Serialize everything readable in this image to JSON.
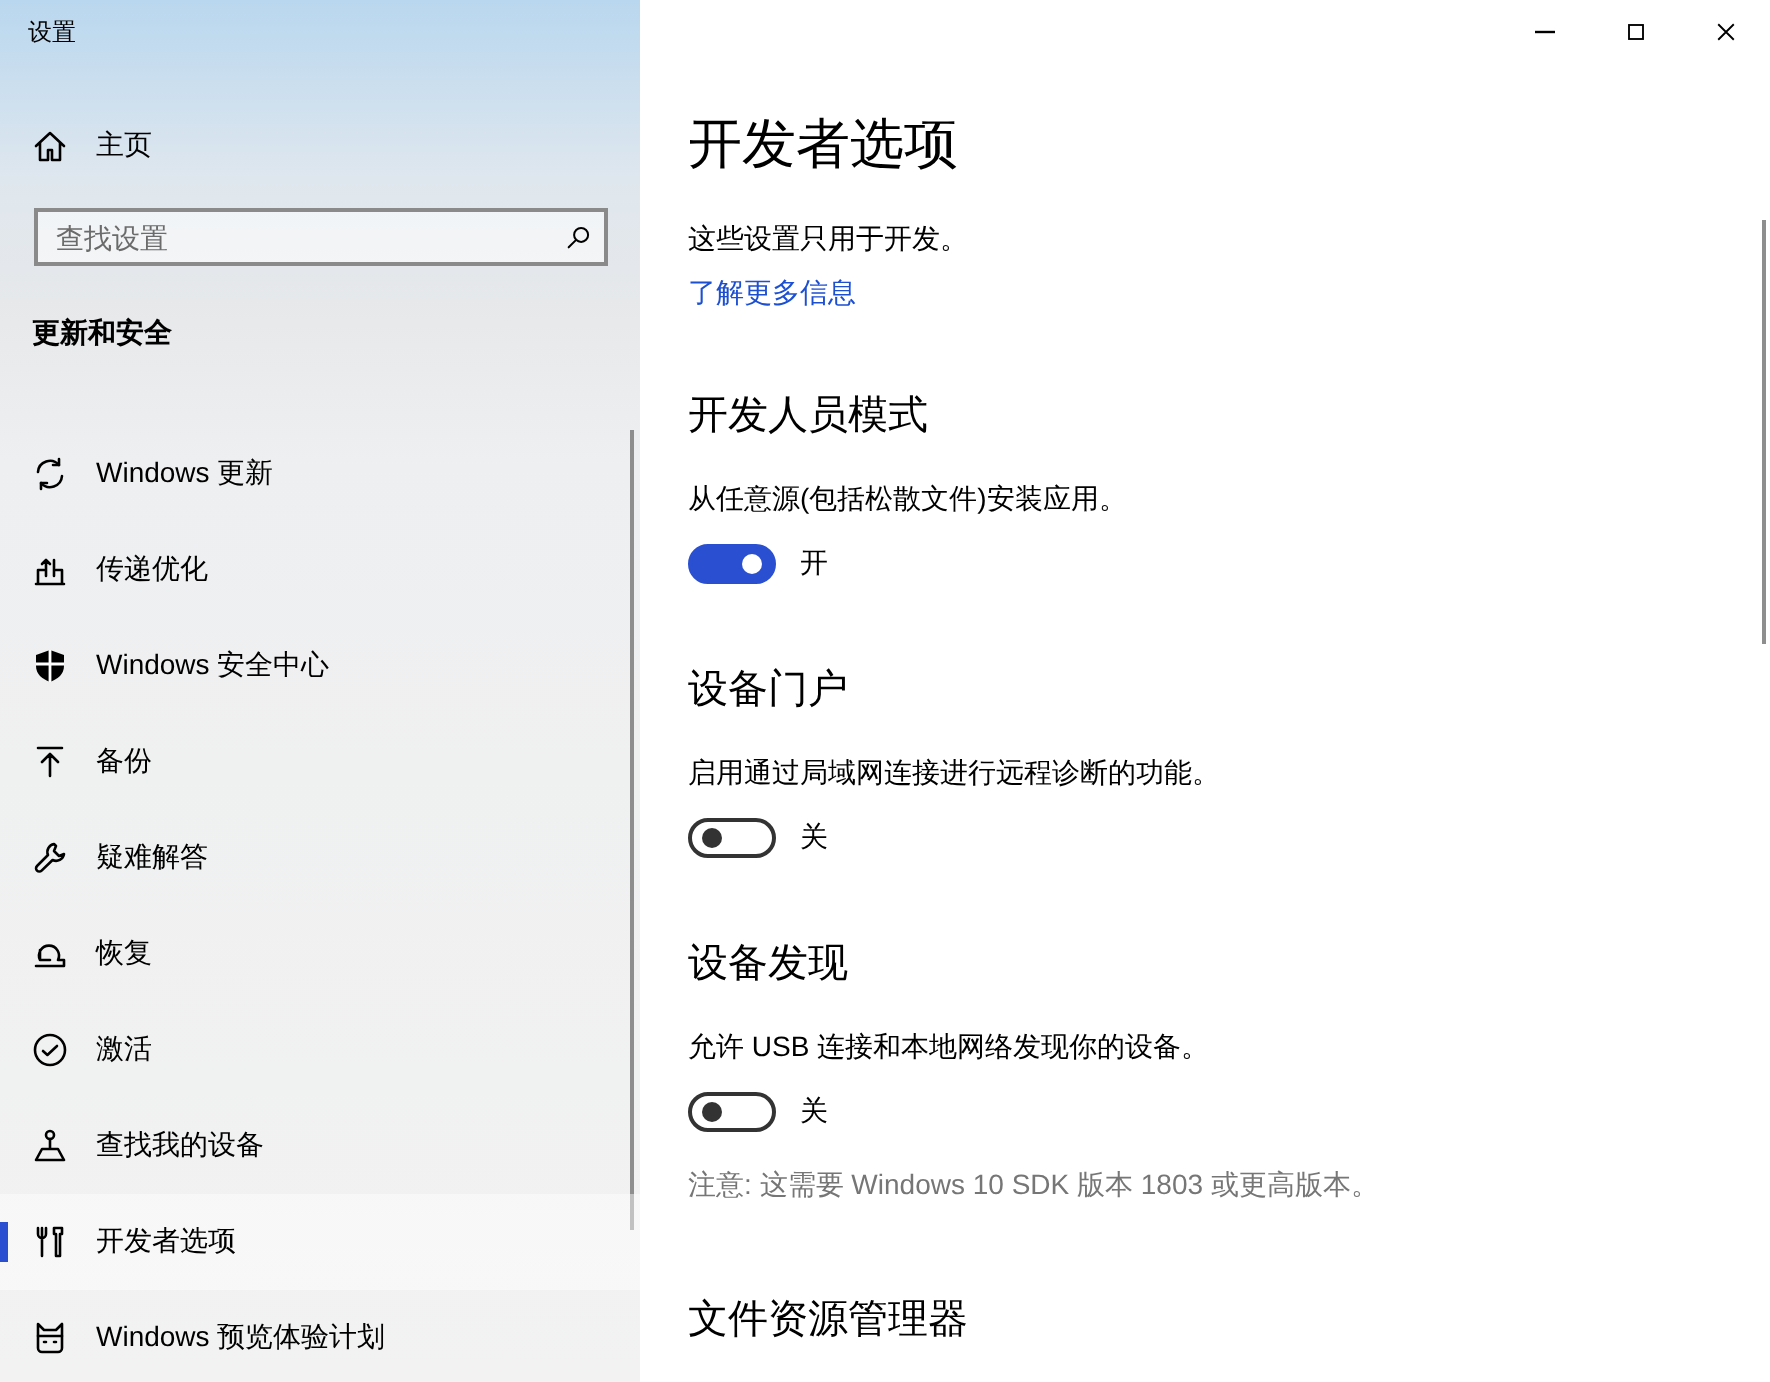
{
  "window": {
    "title": "设置"
  },
  "sidebar": {
    "home": {
      "label": "主页"
    },
    "search": {
      "placeholder": "查找设置"
    },
    "section_title": "更新和安全",
    "items": [
      {
        "label": "Windows 更新",
        "selected": false
      },
      {
        "label": "传递优化",
        "selected": false
      },
      {
        "label": "Windows 安全中心",
        "selected": false
      },
      {
        "label": "备份",
        "selected": false
      },
      {
        "label": "疑难解答",
        "selected": false
      },
      {
        "label": "恢复",
        "selected": false
      },
      {
        "label": "激活",
        "selected": false
      },
      {
        "label": "查找我的设备",
        "selected": false
      },
      {
        "label": "开发者选项",
        "selected": true
      },
      {
        "label": "Windows 预览体验计划",
        "selected": false
      }
    ]
  },
  "page": {
    "title": "开发者选项",
    "description": "这些设置只用于开发。",
    "link": "了解更多信息",
    "sections": [
      {
        "heading": "开发人员模式",
        "description": "从任意源(包括松散文件)安装应用。",
        "toggle": {
          "on": true,
          "state_label": "开"
        }
      },
      {
        "heading": "设备门户",
        "description": "启用通过局域网连接进行远程诊断的功能。",
        "toggle": {
          "on": false,
          "state_label": "关"
        }
      },
      {
        "heading": "设备发现",
        "description": "允许 USB 连接和本地网络发现你的设备。",
        "toggle": {
          "on": false,
          "state_label": "关"
        },
        "note": "注意: 这需要 Windows 10 SDK 版本 1803 或更高版本。"
      },
      {
        "heading": "文件资源管理器"
      }
    ]
  }
}
